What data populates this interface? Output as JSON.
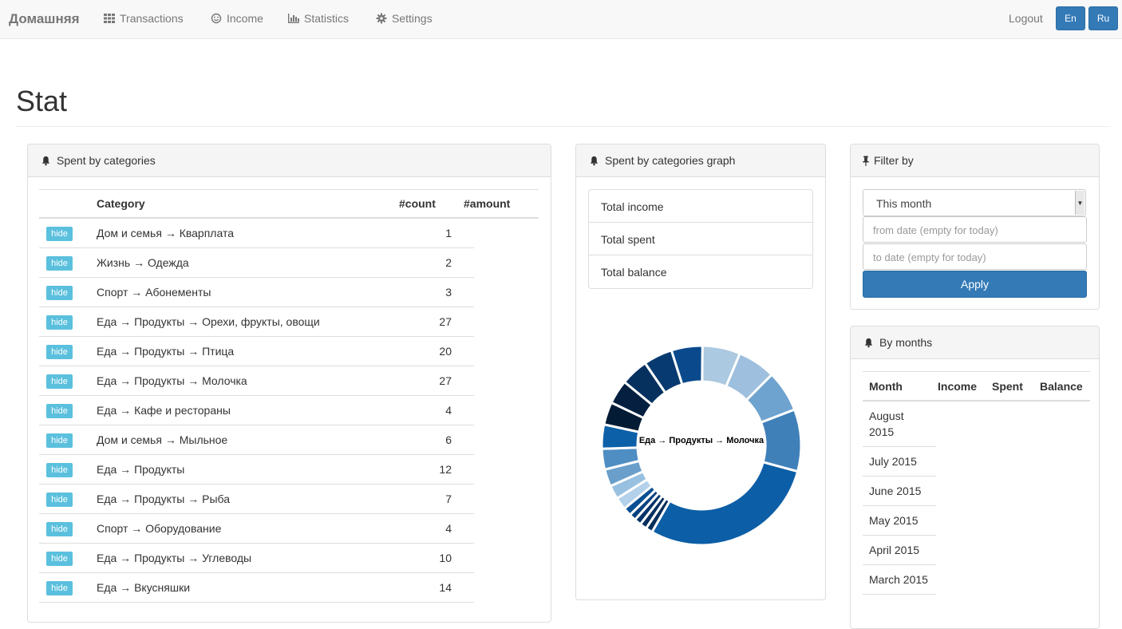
{
  "navbar": {
    "brand": "Домашняя",
    "items": [
      {
        "label": "Transactions",
        "icon": "grid-icon"
      },
      {
        "label": "Income",
        "icon": "smiley-icon"
      },
      {
        "label": "Statistics",
        "icon": "bar-chart-icon"
      },
      {
        "label": "Settings",
        "icon": "gear-icon"
      }
    ],
    "logout": "Logout",
    "lang_en": "En",
    "lang_ru": "Ru",
    "accent_color": "#337ab7"
  },
  "page": {
    "title": "Stat"
  },
  "categories_panel": {
    "heading": "Spent by categories",
    "columns": {
      "category": "Category",
      "count": "#count",
      "amount": "#amount"
    },
    "hide_label": "hide",
    "rows": [
      {
        "category": "Дом и семья → Кварплата",
        "count": "1"
      },
      {
        "category": "Жизнь → Одежда",
        "count": "2"
      },
      {
        "category": "Спорт → Абонементы",
        "count": "3"
      },
      {
        "category": "Еда → Продукты → Орехи, фрукты, овощи",
        "count": "27"
      },
      {
        "category": "Еда → Продукты → Птица",
        "count": "20"
      },
      {
        "category": "Еда → Продукты → Молочка",
        "count": "27"
      },
      {
        "category": "Еда → Кафе и рестораны",
        "count": "4"
      },
      {
        "category": "Дом и семья → Мыльное",
        "count": "6"
      },
      {
        "category": "Еда → Продукты",
        "count": "12"
      },
      {
        "category": "Еда → Продукты → Рыба",
        "count": "7"
      },
      {
        "category": "Спорт → Оборудование",
        "count": "4"
      },
      {
        "category": "Еда → Продукты → Углеводы",
        "count": "10"
      },
      {
        "category": "Еда → Вкусняшки",
        "count": "14"
      }
    ]
  },
  "graph_panel": {
    "heading": "Spent by categories graph",
    "totals": {
      "income": "Total income",
      "spent": "Total spent",
      "balance": "Total balance"
    }
  },
  "chart_data": {
    "type": "pie",
    "center_label": "Еда → Продукты → Молочка",
    "values": [
      5.5,
      5.5,
      6,
      9,
      26,
      1,
      1,
      1,
      1,
      1.2,
      1.8,
      2,
      2.5,
      3,
      3.5,
      3.3,
      3.5,
      4,
      4.2,
      4.5
    ],
    "colors": [
      "#abc9e0",
      "#9ebfdd",
      "#6fa3cf",
      "#3f80b9",
      "#0c5ea6",
      "#052e5b",
      "#062f5f",
      "#06346a",
      "#08427f",
      "#0a4f93",
      "#b3d1ea",
      "#98c0e0",
      "#6a9fcb",
      "#4e8ec3",
      "#0c60a8",
      "#031b35",
      "#041f3f",
      "#06315f",
      "#073a70",
      "#0a4a8c"
    ]
  },
  "filter_panel": {
    "heading": "Filter by",
    "selected": "This month",
    "from_placeholder": "from date (empty for today)",
    "to_placeholder": "to date (empty for today)",
    "apply": "Apply"
  },
  "months_panel": {
    "heading": "By months",
    "columns": {
      "month": "Month",
      "income": "Income",
      "spent": "Spent",
      "balance": "Balance"
    },
    "rows": [
      {
        "month": "August 2015"
      },
      {
        "month": "July 2015"
      },
      {
        "month": "June 2015"
      },
      {
        "month": "May 2015"
      },
      {
        "month": "April 2015"
      },
      {
        "month": "March 2015"
      }
    ]
  }
}
